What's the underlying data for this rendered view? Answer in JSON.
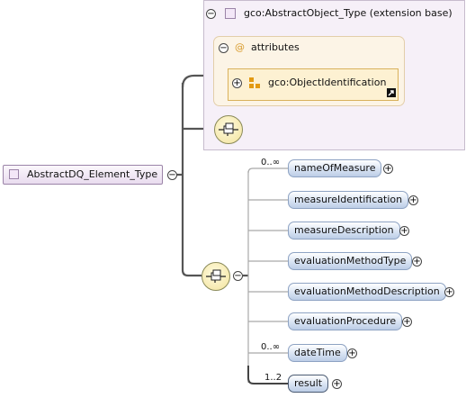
{
  "root": {
    "label": "AbstractDQ_Element_Type"
  },
  "extension": {
    "label": "gco:AbstractObject_Type (extension base)",
    "attributes_label": "attributes",
    "attribute_group": "gco:ObjectIdentification"
  },
  "elements": [
    {
      "label": "nameOfMeasure",
      "cardinality": "0..∞",
      "required": false
    },
    {
      "label": "measureIdentification",
      "cardinality": "",
      "required": false
    },
    {
      "label": "measureDescription",
      "cardinality": "",
      "required": false
    },
    {
      "label": "evaluationMethodType",
      "cardinality": "",
      "required": false
    },
    {
      "label": "evaluationMethodDescription",
      "cardinality": "",
      "required": false
    },
    {
      "label": "evaluationProcedure",
      "cardinality": "",
      "required": false
    },
    {
      "label": "dateTime",
      "cardinality": "0..∞",
      "required": false
    },
    {
      "label": "result",
      "cardinality": "1..2",
      "required": true
    }
  ],
  "glyphs": {
    "collapse": "−",
    "expand": "+",
    "attribute_symbol": "@"
  },
  "colors": {
    "element_fill": "#d8e3f3",
    "element_border": "#8ea3c3",
    "extension_fill": "#f6f0f8",
    "attributes_fill": "#fcf4e6",
    "sequence_fill": "#f6eab0"
  }
}
